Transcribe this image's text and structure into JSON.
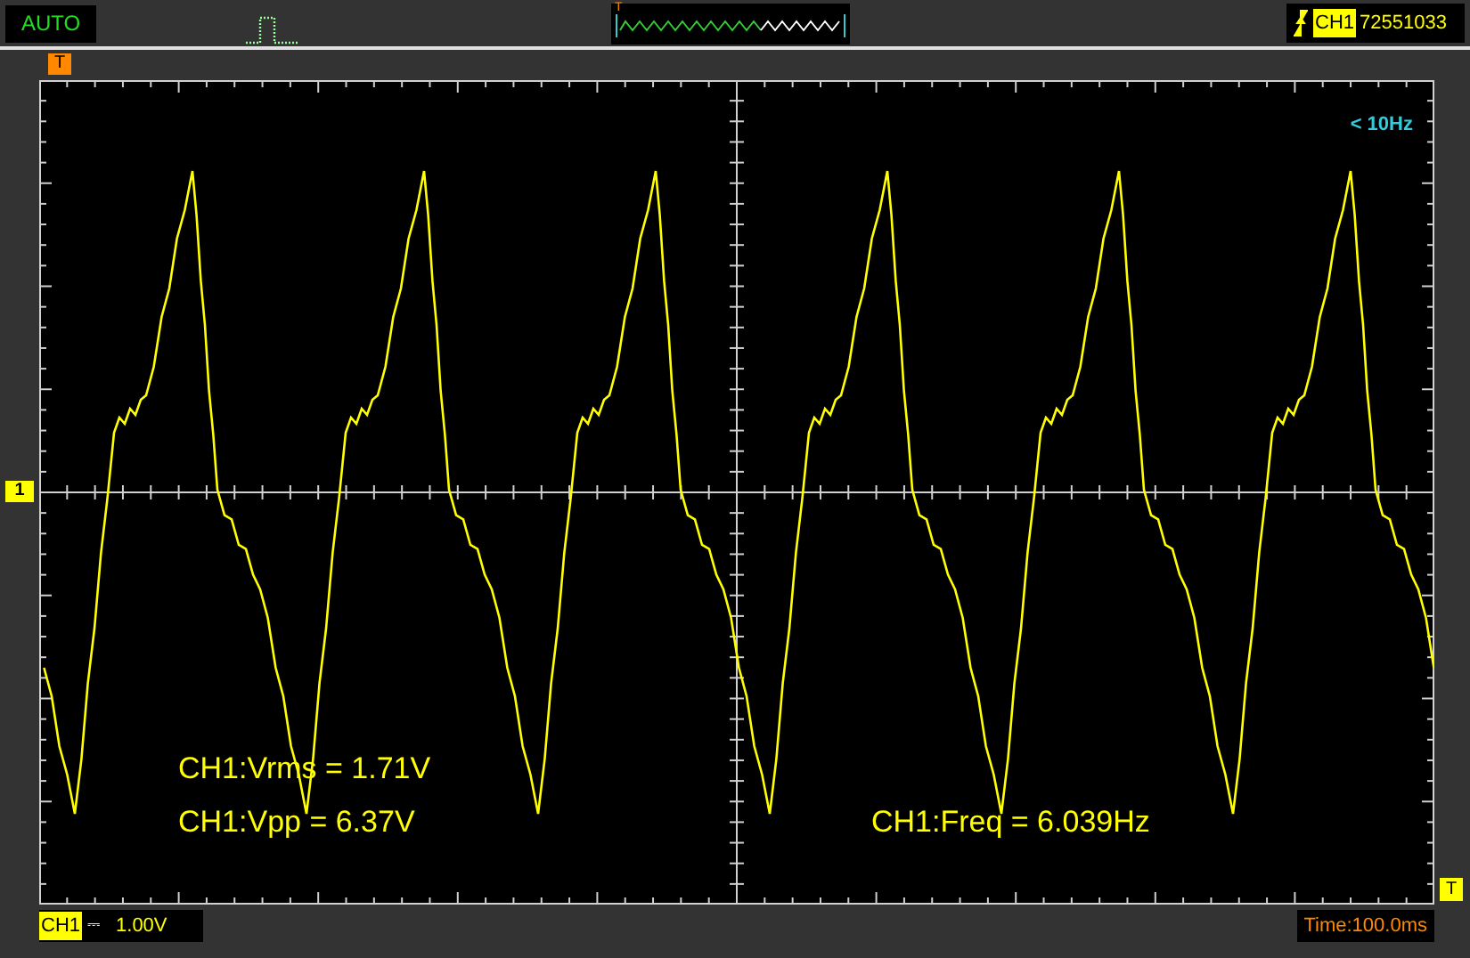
{
  "top_bar": {
    "mode": "AUTO",
    "trigger_marker": "T",
    "trigger_channel": "CH1",
    "trigger_level": "72551033"
  },
  "screen": {
    "trigger_position_marker": "T",
    "channel_marker": "1",
    "trigger_level_marker": "T",
    "frequency_note": "< 10Hz",
    "measurements": [
      {
        "text": "CH1:Vrms = 1.71V"
      },
      {
        "text": "CH1:Vpp = 6.37V"
      },
      {
        "text": "CH1:Freq = 6.039Hz"
      }
    ]
  },
  "bottom_bar": {
    "channel": "CH1",
    "coupling": "⎓",
    "volts_per_div": "1.00V",
    "timebase": "Time:100.0ms"
  }
}
